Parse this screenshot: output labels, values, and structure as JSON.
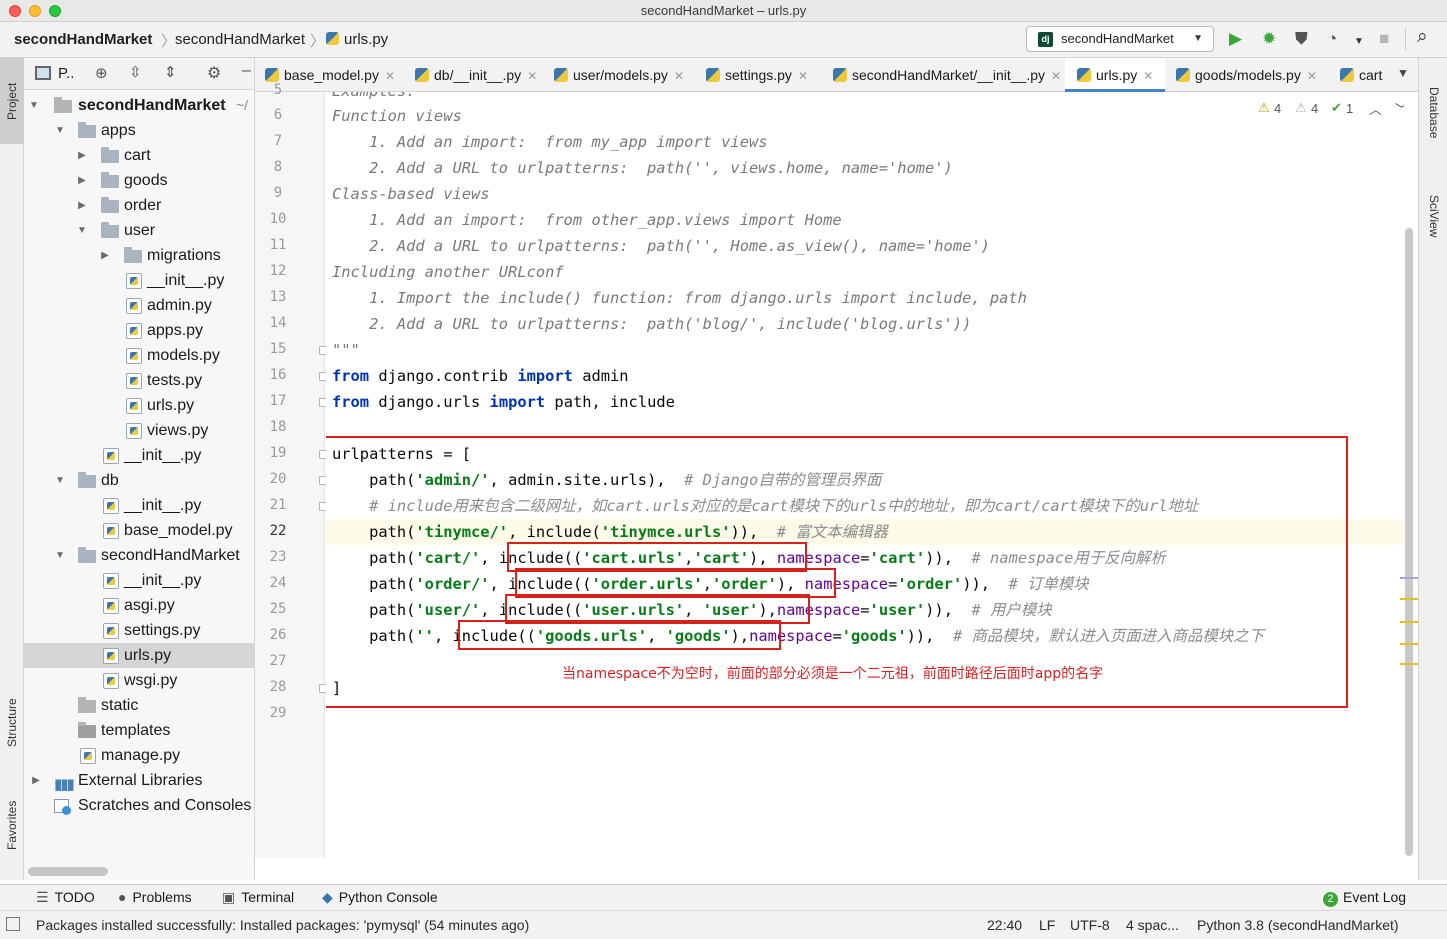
{
  "window": {
    "title": "secondHandMarket – urls.py"
  },
  "navbar": {
    "crumbs": [
      "secondHandMarket",
      "secondHandMarket",
      "urls.py"
    ],
    "run_config": "secondHandMarket"
  },
  "left_strip": {
    "tabs": [
      "Project",
      "Structure",
      "Favorites"
    ]
  },
  "project": {
    "header": "P..",
    "tree": [
      {
        "label": "secondHandMarket",
        "suffix": "~/",
        "type": "root"
      },
      {
        "label": "apps",
        "type": "folder"
      },
      {
        "label": "cart",
        "type": "folder"
      },
      {
        "label": "goods",
        "type": "folder"
      },
      {
        "label": "order",
        "type": "folder"
      },
      {
        "label": "user",
        "type": "folder"
      },
      {
        "label": "migrations",
        "type": "folder"
      },
      {
        "label": "__init__.py",
        "type": "file"
      },
      {
        "label": "admin.py",
        "type": "file"
      },
      {
        "label": "apps.py",
        "type": "file"
      },
      {
        "label": "models.py",
        "type": "file"
      },
      {
        "label": "tests.py",
        "type": "file"
      },
      {
        "label": "urls.py",
        "type": "file"
      },
      {
        "label": "views.py",
        "type": "file"
      },
      {
        "label": "__init__.py",
        "type": "file"
      },
      {
        "label": "db",
        "type": "folder"
      },
      {
        "label": "__init__.py",
        "type": "file"
      },
      {
        "label": "base_model.py",
        "type": "file"
      },
      {
        "label": "secondHandMarket",
        "type": "folder"
      },
      {
        "label": "__init__.py",
        "type": "file"
      },
      {
        "label": "asgi.py",
        "type": "file"
      },
      {
        "label": "settings.py",
        "type": "file"
      },
      {
        "label": "urls.py",
        "type": "file"
      },
      {
        "label": "wsgi.py",
        "type": "file"
      },
      {
        "label": "static",
        "type": "folder"
      },
      {
        "label": "templates",
        "type": "folder"
      },
      {
        "label": "manage.py",
        "type": "file"
      },
      {
        "label": "External Libraries",
        "type": "lib"
      },
      {
        "label": "Scratches and Consoles",
        "type": "scratch"
      }
    ]
  },
  "tabs": [
    "base_model.py",
    "db/__init__.py",
    "user/models.py",
    "settings.py",
    "secondHandMarket/__init__.py",
    "urls.py",
    "goods/models.py",
    "cart"
  ],
  "inspections": {
    "warn1": "4",
    "warn2": "4",
    "ok": "1"
  },
  "right_strip": {
    "tabs": [
      "Database",
      "SciView"
    ]
  },
  "editor": {
    "line_numbers": [
      "5",
      "6",
      "7",
      "8",
      "9",
      "10",
      "11",
      "12",
      "13",
      "14",
      "15",
      "16",
      "17",
      "18",
      "19",
      "20",
      "21",
      "22",
      "23",
      "24",
      "25",
      "26",
      "27",
      "28",
      "29"
    ],
    "lines": {
      "l5": "Examples:",
      "l6": "Function views",
      "l7": "    1. Add an import:  from my_app import views",
      "l8": "    2. Add a URL to urlpatterns:  path('', views.home, name='home')",
      "l9": "Class-based views",
      "l10": "    1. Add an import:  from other_app.views import Home",
      "l11": "    2. Add a URL to urlpatterns:  path('', Home.as_view(), name='home')",
      "l12": "Including another URLconf",
      "l13": "    1. Import the include() function: from django.urls import include, path",
      "l14": "    2. Add a URL to urlpatterns:  path('blog/', include('blog.urls'))",
      "l15": "\"\"\"",
      "l16_from": "from",
      "l16_mod": " django.contrib ",
      "l16_import": "import",
      "l16_name": " admin",
      "l17_from": "from",
      "l17_mod": " django.urls ",
      "l17_import": "import",
      "l17_name": " path, include",
      "l19": "urlpatterns = [",
      "l20_a": "    path(",
      "l20_s": "'admin/'",
      "l20_b": ", admin.site.urls),  ",
      "l20_c": "# Django自带的管理员界面",
      "l21_c": "    # include用来包含二级网址，如cart.urls对应的是cart模块下的urls中的地址，即为cart/cart模块下的url地址",
      "l22_a": "    path(",
      "l22_s1": "'tinymce/'",
      "l22_b": ", include(",
      "l22_s2": "'tinymce.urls'",
      "l22_c": ")),  ",
      "l22_cmt": "# 富文本编辑器",
      "l23_a": "    path(",
      "l23_s1": "'cart/'",
      "l23_b": ", include((",
      "l23_s2": "'cart.urls'",
      "l23_c": ",",
      "l23_s3": "'cart'",
      "l23_d": "), ",
      "l23_p": "namespace",
      "l23_e": "=",
      "l23_s4": "'cart'",
      "l23_f": ")),  ",
      "l23_cmt": "# namespace用于反向解析",
      "l24_a": "    path(",
      "l24_s1": "'order/'",
      "l24_b": ", include((",
      "l24_s2": "'order.urls'",
      "l24_c": ",",
      "l24_s3": "'order'",
      "l24_d": "), ",
      "l24_p": "namespace",
      "l24_e": "=",
      "l24_s4": "'order'",
      "l24_f": ")),  ",
      "l24_cmt": "# 订单模块",
      "l25_a": "    path(",
      "l25_s1": "'user/'",
      "l25_b": ", include((",
      "l25_s2": "'user.urls'",
      "l25_c": ", ",
      "l25_s3": "'user'",
      "l25_d": "),",
      "l25_p": "namespace",
      "l25_e": "=",
      "l25_s4": "'user'",
      "l25_f": ")),  ",
      "l25_cmt": "# 用户模块",
      "l26_a": "    path(",
      "l26_s1": "''",
      "l26_b": ", include((",
      "l26_s2": "'goods.urls'",
      "l26_c": ", ",
      "l26_s3": "'goods'",
      "l26_d": "),",
      "l26_p": "namespace",
      "l26_e": "=",
      "l26_s4": "'goods'",
      "l26_f": ")),  ",
      "l26_cmt": "# 商品模块，默认进入页面进入商品模块之下",
      "l28": "]"
    },
    "annotation": "当namespace不为空时，前面的部分必须是一个二元祖，前面时路径后面时app的名字"
  },
  "bottom_tools": [
    "TODO",
    "Problems",
    "Terminal",
    "Python Console",
    "Event Log"
  ],
  "event_log_count": "2",
  "status": {
    "message": "Packages installed successfully: Installed packages: 'pymysql' (54 minutes ago)",
    "position": "22:40",
    "line_sep": "LF",
    "encoding": "UTF-8",
    "indent": "4 spac...",
    "interpreter": "Python 3.8 (secondHandMarket)"
  }
}
